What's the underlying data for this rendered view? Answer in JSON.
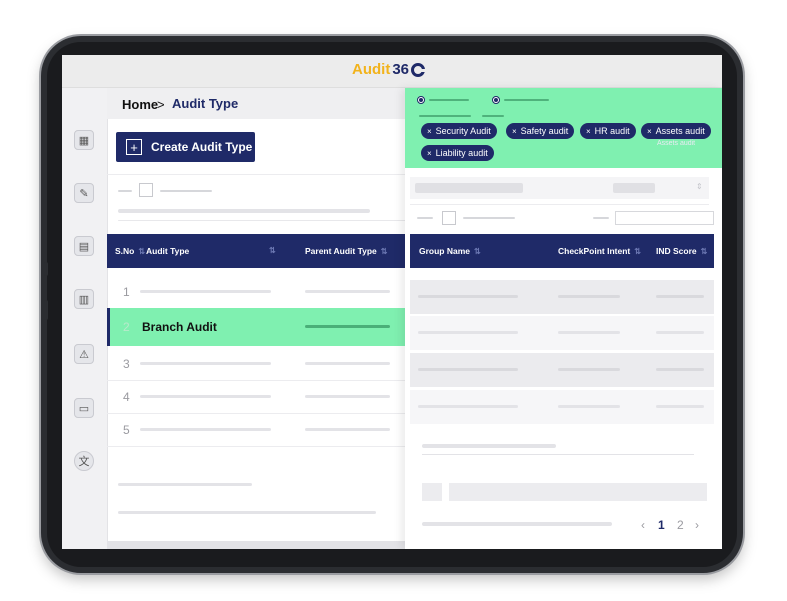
{
  "app": {
    "logo_text": "Audit",
    "logo_number": "36"
  },
  "sidebar": {
    "items": [
      {
        "icon": "dashboard-icon"
      },
      {
        "icon": "presentation-icon"
      },
      {
        "icon": "calculator-icon"
      },
      {
        "icon": "report-chart-icon"
      },
      {
        "icon": "warning-document-icon"
      },
      {
        "icon": "devices-icon"
      },
      {
        "icon": "translate-icon"
      }
    ]
  },
  "breadcrumb": {
    "home": "Home",
    "separator": ">",
    "current": "Audit Type"
  },
  "toolbar": {
    "create_label": "Create Audit Type",
    "plus_glyph": "+"
  },
  "left_table": {
    "headers": {
      "sno": "S.No",
      "audit_type": "Audit Type",
      "parent": "Parent Audit Type"
    },
    "rows": [
      {
        "num": "1",
        "name": ""
      },
      {
        "num": "2",
        "name": "Branch Audit"
      },
      {
        "num": "3",
        "name": ""
      },
      {
        "num": "4",
        "name": ""
      },
      {
        "num": "5",
        "name": ""
      }
    ]
  },
  "filter_chips": [
    {
      "label": "Security Audit"
    },
    {
      "label": "Safety audit"
    },
    {
      "label": "HR audit"
    },
    {
      "label": "Assets audit"
    },
    {
      "label": "Liability audit"
    }
  ],
  "chip_close_glyph": "×",
  "ghost_text": "Assets audit",
  "right_table": {
    "headers": {
      "group": "Group Name",
      "intent": "CheckPoint Intent",
      "score": "IND Score"
    }
  },
  "pagination": {
    "prev": "‹",
    "pages": [
      "1",
      "2"
    ],
    "next": "›"
  },
  "colors": {
    "brand_navy": "#1f2a68",
    "brand_yellow": "#f2b31c",
    "highlight_green": "#7ff0b0"
  }
}
